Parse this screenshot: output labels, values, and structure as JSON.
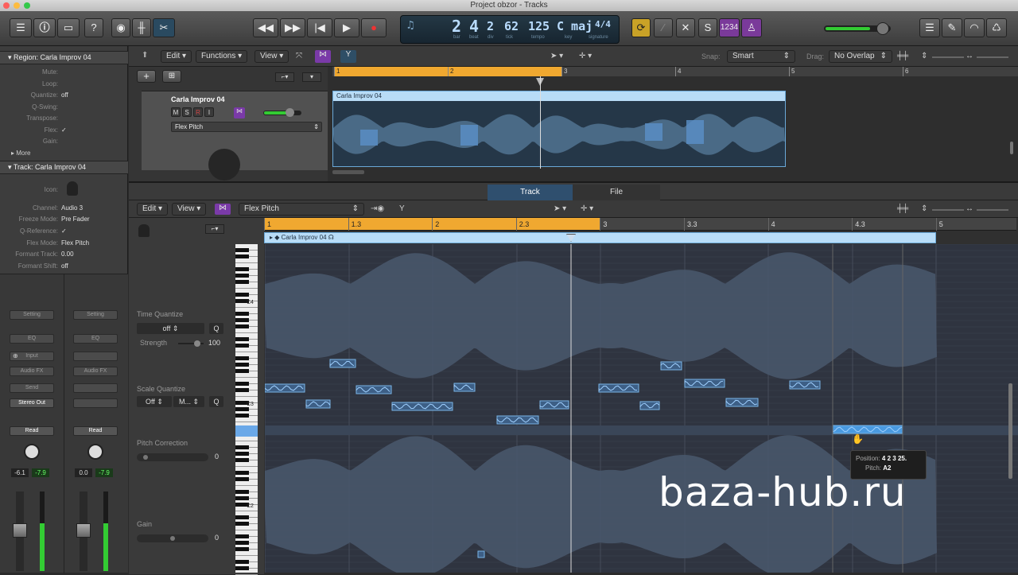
{
  "window": {
    "title": "Project obzor - Tracks"
  },
  "toolbar": {
    "lcd": {
      "bar": "2",
      "beat": "4",
      "div": "2",
      "tick": "62",
      "tempo": "125",
      "key": "C maj",
      "signature": "4/4",
      "labels": {
        "bar": "bar",
        "beat": "beat",
        "div": "div",
        "tick": "tick",
        "tempo": "tempo",
        "key": "key",
        "signature": "signature"
      }
    },
    "count_in": "1234",
    "s_label": "S"
  },
  "inspector": {
    "region_header": "Region: Carla Improv 04",
    "region_rows": [
      {
        "k": "Mute:",
        "v": ""
      },
      {
        "k": "Loop:",
        "v": ""
      },
      {
        "k": "Quantize:",
        "v": "off"
      },
      {
        "k": "Q-Swing:",
        "v": ""
      },
      {
        "k": "Transpose:",
        "v": ""
      },
      {
        "k": "Flex:",
        "v": "✓"
      },
      {
        "k": "Gain:",
        "v": ""
      }
    ],
    "more": "More",
    "track_header": "Track: Carla Improv 04",
    "track_rows": [
      {
        "k": "Icon:",
        "v": ""
      },
      {
        "k": "Channel:",
        "v": "Audio 3"
      },
      {
        "k": "Freeze Mode:",
        "v": "Pre Fader"
      },
      {
        "k": "Q-Reference:",
        "v": "✓"
      },
      {
        "k": "Flex Mode:",
        "v": "Flex Pitch"
      },
      {
        "k": "Formant Track:",
        "v": "0.00"
      },
      {
        "k": "Formant Shift:",
        "v": "off"
      }
    ],
    "strips": [
      {
        "setting": "Setting",
        "eq": "EQ",
        "input": "Input",
        "fx": "Audio FX",
        "send": "Send",
        "out": "Stereo Out",
        "read": "Read",
        "vol": "-6.1",
        "peak": "-7.9"
      },
      {
        "setting": "Setting",
        "eq": "EQ",
        "input": "",
        "fx": "Audio FX",
        "send": "",
        "out": "",
        "read": "Read",
        "vol": "0.0",
        "peak": "-7.9"
      }
    ]
  },
  "tracks": {
    "menus": {
      "edit": "Edit",
      "functions": "Functions",
      "view": "View"
    },
    "snap_label": "Snap:",
    "snap_value": "Smart",
    "drag_label": "Drag:",
    "drag_value": "No Overlap",
    "ruler": [
      "1",
      "2",
      "3",
      "4",
      "5",
      "6"
    ],
    "track_name": "Carla Improv 04",
    "track_buttons": [
      "M",
      "S",
      "R",
      "I"
    ],
    "flex_mode": "Flex Pitch",
    "region_name": "Carla Improv 04"
  },
  "editor": {
    "tabs": [
      {
        "label": "Track"
      },
      {
        "label": "File"
      }
    ],
    "menus": {
      "edit": "Edit",
      "view": "View",
      "flex": "Flex Pitch"
    },
    "ruler": [
      "1",
      "1.3",
      "2",
      "2.3",
      "3",
      "3.3",
      "4",
      "4.3",
      "5"
    ],
    "region_name": "Carla Improv 04",
    "key_labels": [
      "C4",
      "C3",
      "C2"
    ],
    "time_quantize": {
      "label": "Time Quantize",
      "value": "off",
      "q": "Q",
      "strength_label": "Strength",
      "strength": "100"
    },
    "scale_quantize": {
      "label": "Scale Quantize",
      "value": "Off",
      "scale": "M...",
      "q": "Q"
    },
    "pitch_correction": {
      "label": "Pitch Correction",
      "value": "0"
    },
    "gain": {
      "label": "Gain",
      "value": "0"
    },
    "tooltip": {
      "position_label": "Position:",
      "position": "4 2 3 25.",
      "pitch_label": "Pitch:",
      "pitch": "A2"
    }
  },
  "watermark": "baza-hub.ru"
}
